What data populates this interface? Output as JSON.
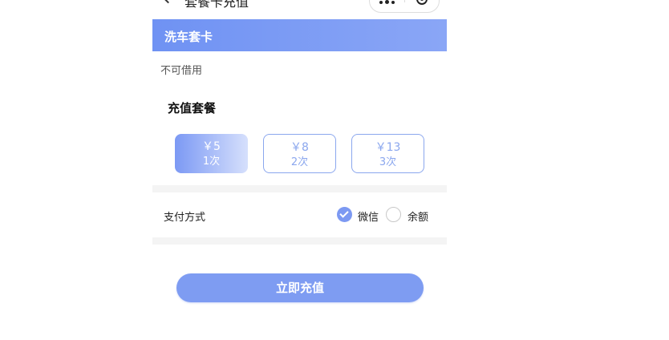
{
  "navbar": {
    "title": "套餐卡充值",
    "back_icon": "chevron-left-icon",
    "more_icon": "more-dots-icon",
    "close_icon": "capsule-close-icon"
  },
  "card": {
    "title": "洗车套卡",
    "description": "不可借用"
  },
  "packages": {
    "section_title": "充值套餐",
    "items": [
      {
        "price": "￥5",
        "count": "1次",
        "selected": true
      },
      {
        "price": "￥8",
        "count": "2次",
        "selected": false
      },
      {
        "price": "￥13",
        "count": "3次",
        "selected": false
      }
    ]
  },
  "payment": {
    "label": "支付方式",
    "options": [
      {
        "label": "微信",
        "checked": true
      },
      {
        "label": "余额",
        "checked": false
      }
    ]
  },
  "submit_label": "立即充值",
  "colors": {
    "accent": "#7e9cf2",
    "header_start": "#6f92f3",
    "header_end": "#8aa6f6"
  }
}
